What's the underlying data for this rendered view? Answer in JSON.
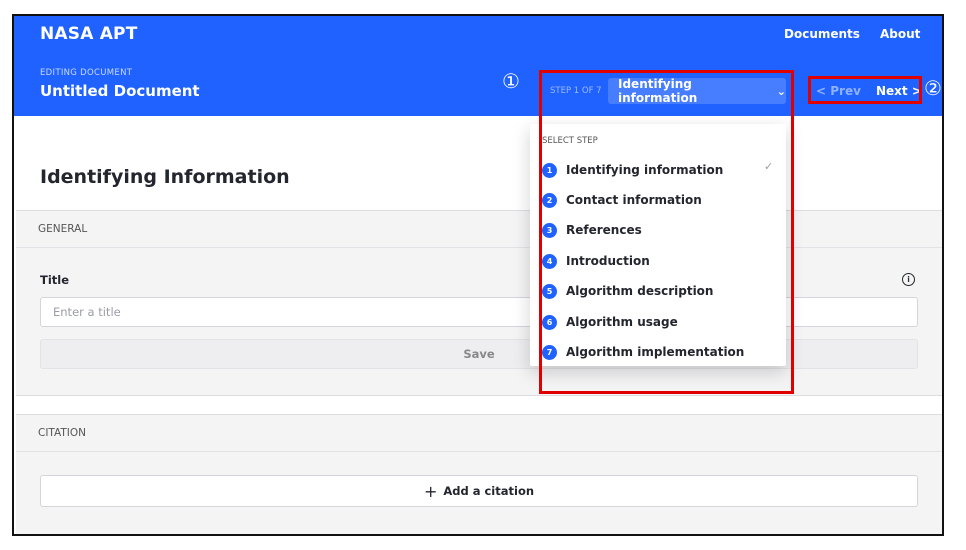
{
  "header": {
    "brand": "NASA APT",
    "nav": {
      "documents": "Documents",
      "about": "About"
    },
    "editing_label": "EDITING DOCUMENT",
    "document_title": "Untitled Document",
    "step_indicator": "STEP 1 OF 7",
    "step_select": "Identifying information",
    "prev": "< Prev",
    "next": "Next >"
  },
  "dropdown": {
    "title": "SELECT STEP",
    "items": [
      {
        "num": "1",
        "label": "Identifying information",
        "selected": true
      },
      {
        "num": "2",
        "label": "Contact information"
      },
      {
        "num": "3",
        "label": "References"
      },
      {
        "num": "4",
        "label": "Introduction"
      },
      {
        "num": "5",
        "label": "Algorithm description"
      },
      {
        "num": "6",
        "label": "Algorithm usage"
      },
      {
        "num": "7",
        "label": "Algorithm implementation"
      }
    ]
  },
  "main": {
    "page_title": "Identifying Information",
    "general": {
      "section_label": "GENERAL",
      "title_label": "Title",
      "title_placeholder": "Enter a title",
      "title_value": "",
      "save": "Save"
    },
    "citation": {
      "section_label": "CITATION",
      "add": "Add a citation"
    }
  },
  "annotations": {
    "callout_1": "①",
    "callout_2": "②"
  },
  "colors": {
    "brand_blue": "#1f62ff",
    "highlight_red": "#e10000"
  }
}
